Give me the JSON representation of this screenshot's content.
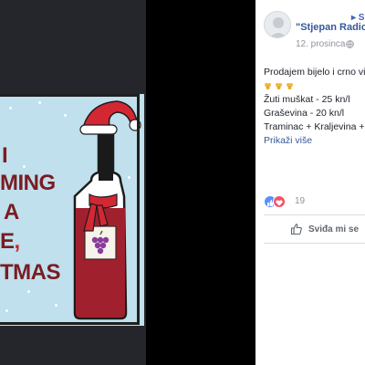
{
  "post": {
    "author": "\"Stjepan Radic",
    "options_icon": "more-icon",
    "date": "12. prosinca",
    "privacy_icon": "globe-icon",
    "body_lines": [
      "Prodajem bijelo i crno vi",
      "Žuti muškat - 25 kn/l",
      "Graševina - 20 kn/l",
      "Traminac + Kraljevina +"
    ],
    "emoji_icons": [
      "grapes-icon",
      "grapes-icon",
      "grapes-icon"
    ],
    "see_more": "Prikaži više",
    "reaction_icons": [
      "like-reaction-icon",
      "love-reaction-icon"
    ],
    "reaction_count": "19",
    "like_button": "Sviđa mi se",
    "accent_color": "#365899"
  },
  "image": {
    "greeting_lines": [
      "I",
      "MING",
      "A",
      "E",
      "TMAS"
    ],
    "greeting_comma": ",",
    "colors": {
      "background": "#bfe0ec",
      "text": "#7a1c22",
      "accent": "#cf2230",
      "bottle": "#a0212d"
    }
  }
}
